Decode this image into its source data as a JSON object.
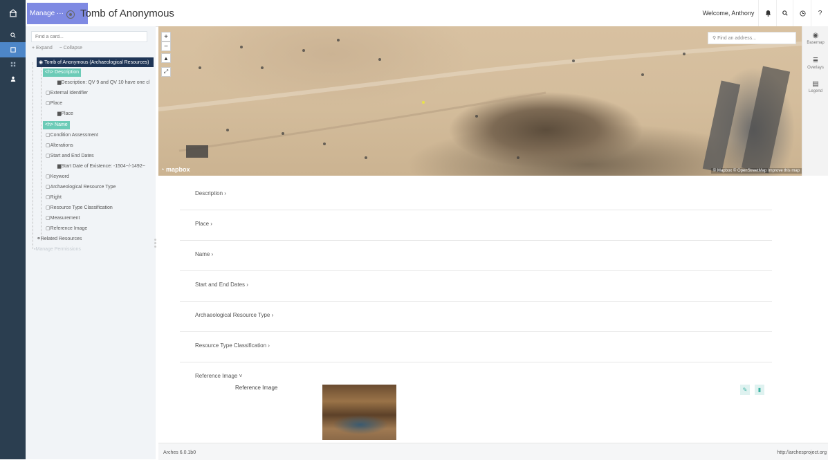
{
  "app": {
    "title": "Tomb of Anonymous",
    "manage_label": "Manage"
  },
  "header": {
    "welcome": "Welcome, Anthony",
    "icons": [
      "bell-icon",
      "search-icon",
      "clock-icon",
      "help-icon"
    ]
  },
  "leftnav": {
    "items": [
      "search-icon",
      "card-icon",
      "grid-icon",
      "user-icon"
    ]
  },
  "tree": {
    "filter_placeholder": "Find a card...",
    "expand_label": "+ Expand",
    "collapse_label": "− Collapse",
    "root": "Tomb of Anonymous (Archaeological Resources)",
    "nodes": {
      "description": "Description",
      "description_child": "Description: QV 9 and QV 10 have one cl",
      "external_identifier": "External Identifier",
      "place": "Place",
      "place_child": "Place",
      "name": "Name",
      "condition": "Condition Assessment",
      "alterations": "Alterations",
      "start_end": "Start and End Dates",
      "start_child": "Start Date of Existence: -1504~/-1492~",
      "keyword": "Keyword",
      "arch_type": "Archaeological Resource Type",
      "right": "Right",
      "rtc": "Resource Type Classification",
      "measurement": "Measurement",
      "ref_image": "Reference Image",
      "related": "Related Resources",
      "permissions": "Manage Permissions"
    }
  },
  "map": {
    "search_placeholder": "Find an address...",
    "logo": "mapbox",
    "attribution": "© Mapbox © OpenStreetMap Improve this map",
    "tools": {
      "basemap": "Basemap",
      "overlays": "Overlays",
      "legend": "Legend"
    },
    "zoom_in": "+",
    "zoom_out": "−"
  },
  "cards": {
    "c1": "Description",
    "c2": "Place",
    "c3": "Name",
    "c4": "Start and End Dates",
    "c5": "Archaeological Resource Type",
    "c6": "Resource Type Classification",
    "c7": "Reference Image",
    "ref_label": "Reference Image"
  },
  "footer": {
    "version": "Arches 6.0.1b0",
    "url": "http://archesproject.org"
  },
  "colors": {
    "nav": "#2b3e50",
    "accent": "#7f8ae3",
    "tree_root": "#1f3556",
    "highlight": "#6ccbb7"
  }
}
